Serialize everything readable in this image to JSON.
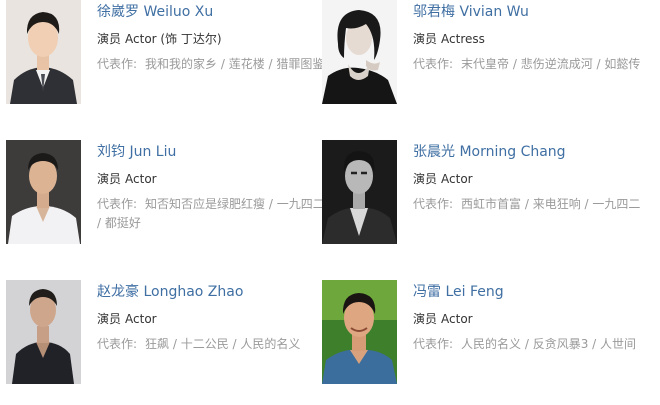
{
  "cast": [
    {
      "name": "徐崴罗 Weiluo Xu",
      "role_label": "演员",
      "role": "Actor (饰 丁达尔)",
      "works_label": "代表作:",
      "works": "我和我的家乡 / 莲花楼 / 猎罪图鉴"
    },
    {
      "name": "邬君梅 Vivian Wu",
      "role_label": "演员",
      "role": "Actress",
      "works_label": "代表作:",
      "works": "末代皇帝 / 悲伤逆流成河 / 如懿传"
    },
    {
      "name": "刘钧 Jun Liu",
      "role_label": "演员",
      "role": "Actor",
      "works_label": "代表作:",
      "works": "知否知否应是绿肥红瘦 / 一九四二 / 都挺好"
    },
    {
      "name": "张晨光 Morning Chang",
      "role_label": "演员",
      "role": "Actor",
      "works_label": "代表作:",
      "works": "西虹市首富 / 来电狂响 / 一九四二"
    },
    {
      "name": "赵龙豪 Longhao Zhao",
      "role_label": "演员",
      "role": "Actor",
      "works_label": "代表作:",
      "works": "狂飙 / 十二公民 / 人民的名义"
    },
    {
      "name": "冯雷 Lei Feng",
      "role_label": "演员",
      "role": "Actor",
      "works_label": "代表作:",
      "works": "人民的名义 / 反贪风暴3 / 人世间"
    }
  ]
}
